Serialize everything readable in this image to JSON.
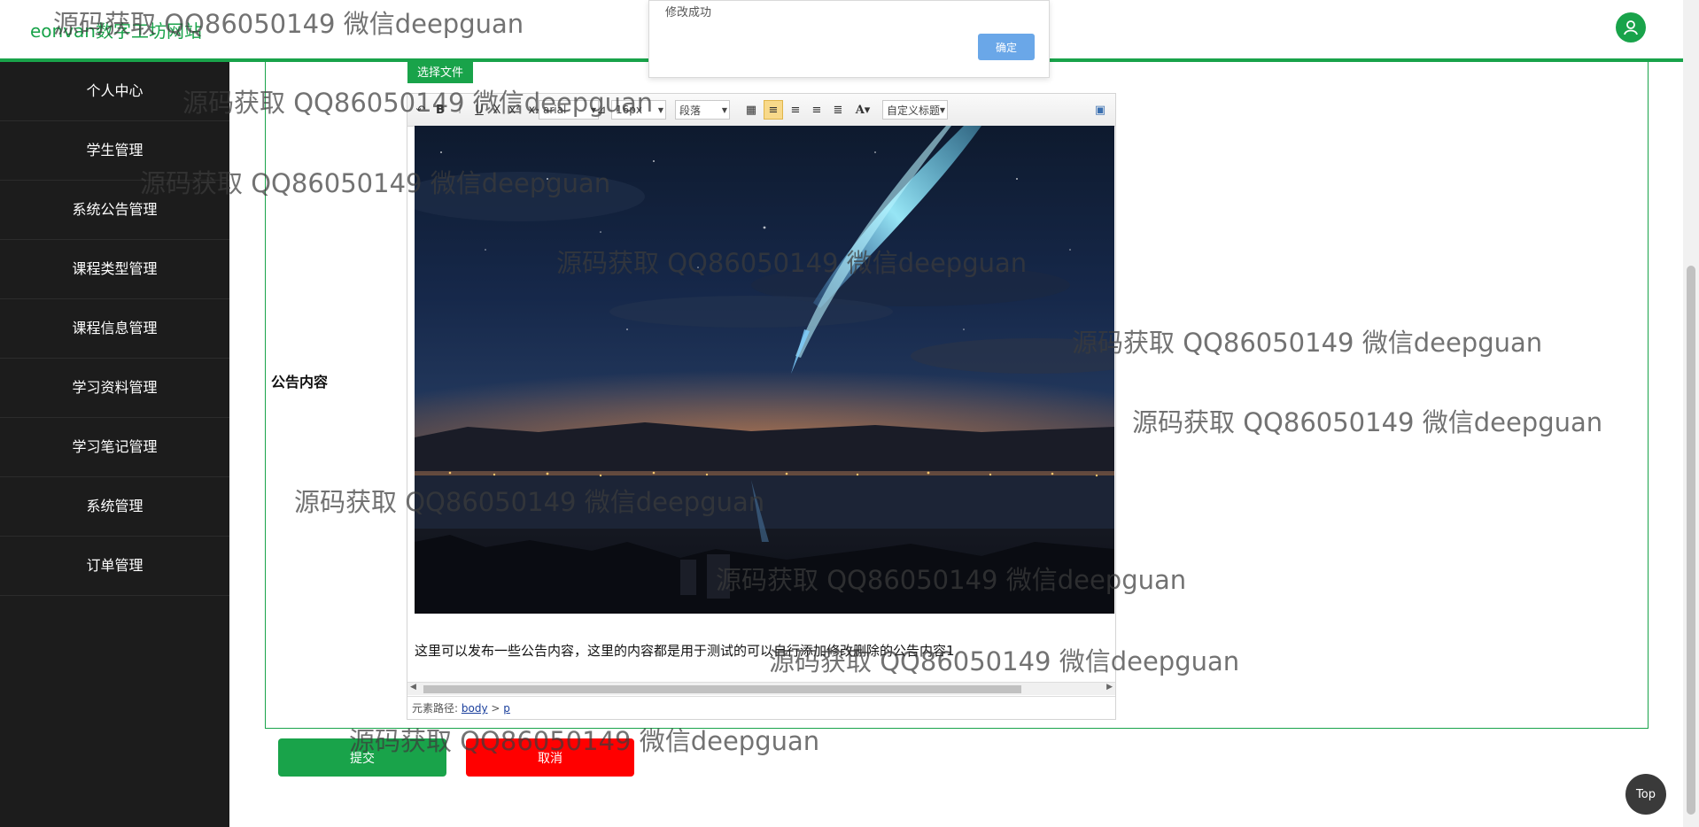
{
  "header": {
    "brand": "eonvan数字工坊网站"
  },
  "sidebar": {
    "items": [
      {
        "label": "个人中心"
      },
      {
        "label": "学生管理"
      },
      {
        "label": "系统公告管理"
      },
      {
        "label": "课程类型管理"
      },
      {
        "label": "课程信息管理"
      },
      {
        "label": "学习资料管理"
      },
      {
        "label": "学习笔记管理"
      },
      {
        "label": "系统管理"
      },
      {
        "label": "订单管理"
      }
    ]
  },
  "form": {
    "file_button": "选择文件",
    "content_label": "公告内容"
  },
  "editor": {
    "toolbar": {
      "font_family": "arial",
      "font_size": "16px",
      "paragraph": "段落",
      "custom_heading": "自定义标题"
    },
    "content_text": "这里可以发布一些公告内容，这里的内容都是用于测试的可以自行添加修改删除的公告内容1",
    "path_label": "元素路径:",
    "path_body": "body",
    "path_sep": ">",
    "path_p": "p"
  },
  "actions": {
    "submit": "提交",
    "cancel": "取消"
  },
  "dialog": {
    "message": "修改成功",
    "ok": "确定"
  },
  "top_button": "Top",
  "watermark": "源码获取 QQ86050149 微信deepguan",
  "colors": {
    "accent": "#19a34a",
    "sidebar_bg": "#1c1c1c",
    "cancel": "#ff0000",
    "dialog_ok": "#6aa7e8"
  }
}
